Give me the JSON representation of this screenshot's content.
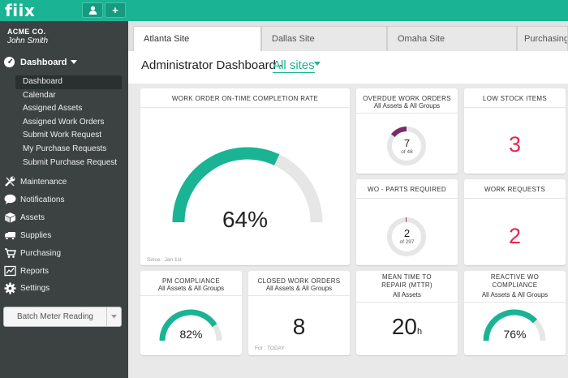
{
  "app": {
    "logo": "fiix"
  },
  "topbar": {
    "user_icon": "user-icon",
    "add_label": "+"
  },
  "sidebar": {
    "company": "ACME CO.",
    "user": "John Smith",
    "dashboard_label": "Dashboard",
    "subitems": [
      "Dashboard",
      "Calendar",
      "Assigned Assets",
      "Assigned Work Orders",
      "Submit Work Request",
      "My Purchase Requests",
      "Submit Purchase Request"
    ],
    "items": [
      {
        "label": "Maintenance",
        "icon": "wrench-icon"
      },
      {
        "label": "Notifications",
        "icon": "speech-bubble-icon"
      },
      {
        "label": "Assets",
        "icon": "box-icon"
      },
      {
        "label": "Supplies",
        "icon": "truck-icon"
      },
      {
        "label": "Purchasing",
        "icon": "cart-icon"
      },
      {
        "label": "Reports",
        "icon": "chart-icon"
      },
      {
        "label": "Settings",
        "icon": "gear-icon"
      }
    ],
    "batch_label": "Batch Meter Reading"
  },
  "tabs": [
    "Atlanta Site",
    "Dallas Site",
    "Omaha Site",
    "Purchasing"
  ],
  "header": {
    "title": "Administrator Dashboard -",
    "sites": "All sites"
  },
  "colors": {
    "accent": "#1ab394",
    "sidebar_bg": "#3c4242",
    "alert_red": "#e8264f",
    "overdue_purple": "#7a2a6b",
    "track_gray": "#e6e6e6"
  },
  "cards": {
    "ontime": {
      "title": "WORK ORDER ON-TIME COMPLETION RATE",
      "value": "64%",
      "fraction": 0.64,
      "footer": "Since : Jan 1st"
    },
    "overdue": {
      "title": "OVERDUE WORK ORDERS",
      "subtitle": "All Assets & All Groups",
      "value": "7",
      "total_label": "of 48",
      "count": 7,
      "total": 48
    },
    "lowstock": {
      "title": "LOW STOCK ITEMS",
      "value": "3"
    },
    "parts": {
      "title": "WO - PARTS REQUIRED",
      "value": "2",
      "total_label": "of 297",
      "count": 2,
      "total": 297
    },
    "requests": {
      "title": "WORK REQUESTS",
      "value": "2"
    },
    "pm": {
      "title": "PM COMPLIANCE",
      "subtitle": "All Assets & All Groups",
      "value": "82%",
      "fraction": 0.82
    },
    "closed": {
      "title": "CLOSED WORK ORDERS",
      "subtitle": "All Assets & All Groups",
      "value": "8",
      "footer": "For : TODAY"
    },
    "mttr": {
      "title": "MEAN TIME TO REPAIR (MTTR)",
      "subtitle": "All Assets",
      "value": "20",
      "unit": "h"
    },
    "reactive": {
      "title": "REACTIVE WO COMPLIANCE",
      "subtitle": "All Assets & All Groups",
      "value": "76%",
      "fraction": 0.76
    }
  }
}
